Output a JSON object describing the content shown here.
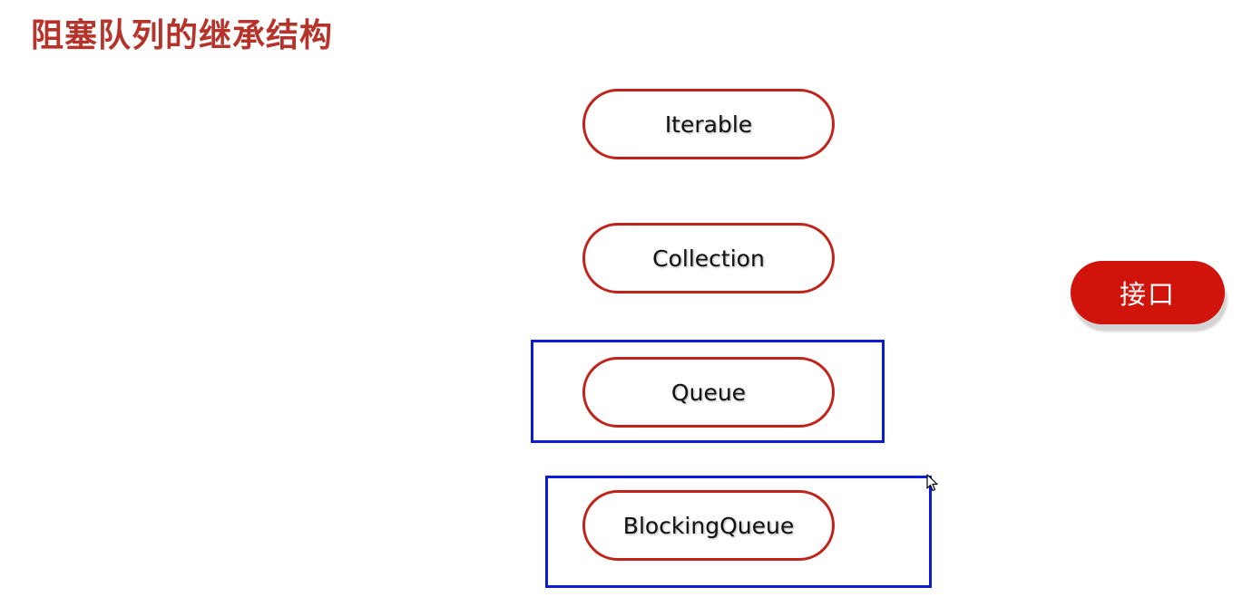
{
  "title": "阻塞队列的继承结构",
  "nodes": [
    {
      "label": "Iterable"
    },
    {
      "label": "Collection"
    },
    {
      "label": "Queue"
    },
    {
      "label": "BlockingQueue"
    }
  ],
  "tag": {
    "label": "接口"
  },
  "colors": {
    "title": "#b5332a",
    "node_border": "#c0231a",
    "highlight_border": "#0a1be0",
    "tag_background": "#d0140b"
  },
  "icons": {
    "cursor": "mouse-pointer-icon"
  }
}
